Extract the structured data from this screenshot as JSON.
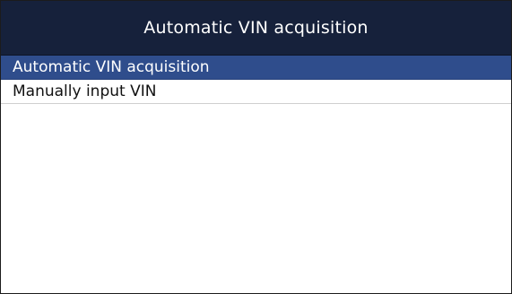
{
  "window": {
    "title": "Automatic VIN acquisition"
  },
  "menu": {
    "selected_index": 0,
    "items": [
      {
        "label": "Automatic VIN acquisition"
      },
      {
        "label": "Manually input VIN"
      }
    ]
  },
  "colors": {
    "title_bar": "#16213b",
    "selected_row": "#2f4d8c",
    "background": "#ffffff"
  }
}
